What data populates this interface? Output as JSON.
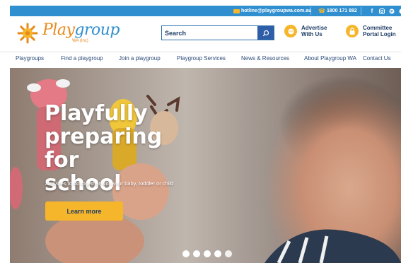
{
  "topbar": {
    "email": "hotline@playgroupwa.com.au",
    "phone": "1800 171 882",
    "social_icons": [
      "facebook-icon",
      "instagram-icon",
      "pinterest-icon",
      "social-icon"
    ]
  },
  "logo": {
    "word_a": "Play",
    "word_b": "group",
    "sub": "WA (Inc)"
  },
  "search": {
    "placeholder": "Search",
    "button_icon": "search-icon"
  },
  "header_links": [
    {
      "line1": "Advertise",
      "line2": "With Us",
      "icon": "megaphone-icon"
    },
    {
      "line1": "Committee",
      "line2": "Portal Login",
      "icon": "lock-icon"
    }
  ],
  "nav": [
    "Playgroups",
    "Find a playgroup",
    "Join a playgroup",
    "Playgroup Services",
    "News & Resources",
    "About Playgroup WA",
    "Contact Us"
  ],
  "hero": {
    "title_1": "Playfully",
    "title_2": "preparing for",
    "title_3": "school",
    "tagline": "Activities to do together with your baby, toddler or child",
    "cta": "Learn more",
    "slide_count": 5
  },
  "colors": {
    "topbar": "#2f8fcf",
    "accent": "#f6b62b",
    "brand_orange": "#e88a1a",
    "navy": "#1f3d66"
  }
}
